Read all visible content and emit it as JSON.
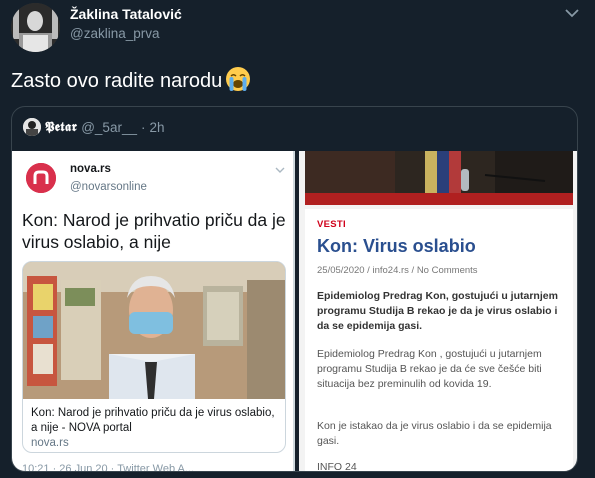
{
  "tweet": {
    "author_name": "Žaklina Tatalović",
    "author_handle": "@zaklina_prva",
    "text": "Zasto ovo radite narodu",
    "emoji": "loudly-crying-face-emoji"
  },
  "quoted": {
    "author_name": "𝕻𝖊𝖙𝖆𝖗",
    "author_handle": "@_5ar__",
    "dot": "·",
    "time": "2h",
    "left_shot": {
      "account_name": "nova.rs",
      "account_handle": "@novarsonline",
      "headline": "Kon: Narod je prihvatio priču da je virus oslabio, a nije",
      "card_title": "Kon: Narod je prihvatio priču da je virus oslabio, a nije - NOVA portal",
      "card_source": "nova.rs",
      "footer": "10:21 · 26 Jun 20 · Twitter Web A..."
    },
    "right_shot": {
      "tag": "VESTI",
      "title": "Kon: Virus oslabio",
      "meta": "25/05/2020 / info24.rs / No Comments",
      "lead": "Epidemiolog Predrag Kon, gostujući u jutarnjem programu Studija B rekao  je da je virus oslabio i da se epidemija gasi.",
      "body1": "Epidemiolog Predrag Kon , gostujući u jutarnjem programu Studija B rekao  je da će sve češće biti situacija bez preminulih od kovida 19.",
      "body2": "Kon je istakao da je  virus oslabio i da se epidemija gasi.",
      "sign": "INFO 24"
    }
  },
  "colors": {
    "background": "#15202b",
    "secondary_text": "#8899a6",
    "border": "#38444d",
    "news_red": "#d0021b",
    "news_title_blue": "#2a4f8f",
    "nova_brand": "#d9304c"
  },
  "icons": {
    "caret": "chevron-down-icon",
    "nova_logo": "nova-logo-icon"
  }
}
